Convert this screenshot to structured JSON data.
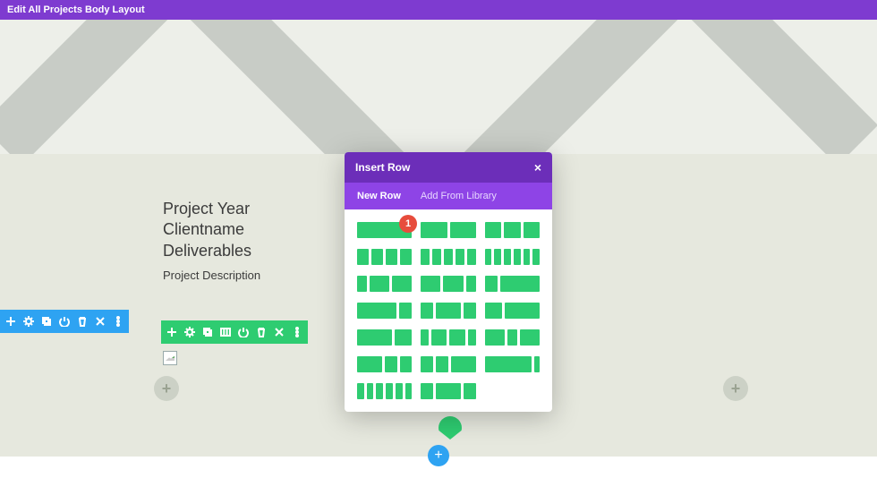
{
  "topbar": {
    "title": "Edit All Projects Body Layout"
  },
  "project": {
    "line1": "Project Year",
    "line2": "Clientname",
    "line3": "Deliverables",
    "desc": "Project Description"
  },
  "badge1": "1",
  "dialog": {
    "title": "Insert Row",
    "tab_new": "New Row",
    "tab_lib": "Add From Library"
  },
  "icons": {
    "plus": "+",
    "close": "×"
  }
}
